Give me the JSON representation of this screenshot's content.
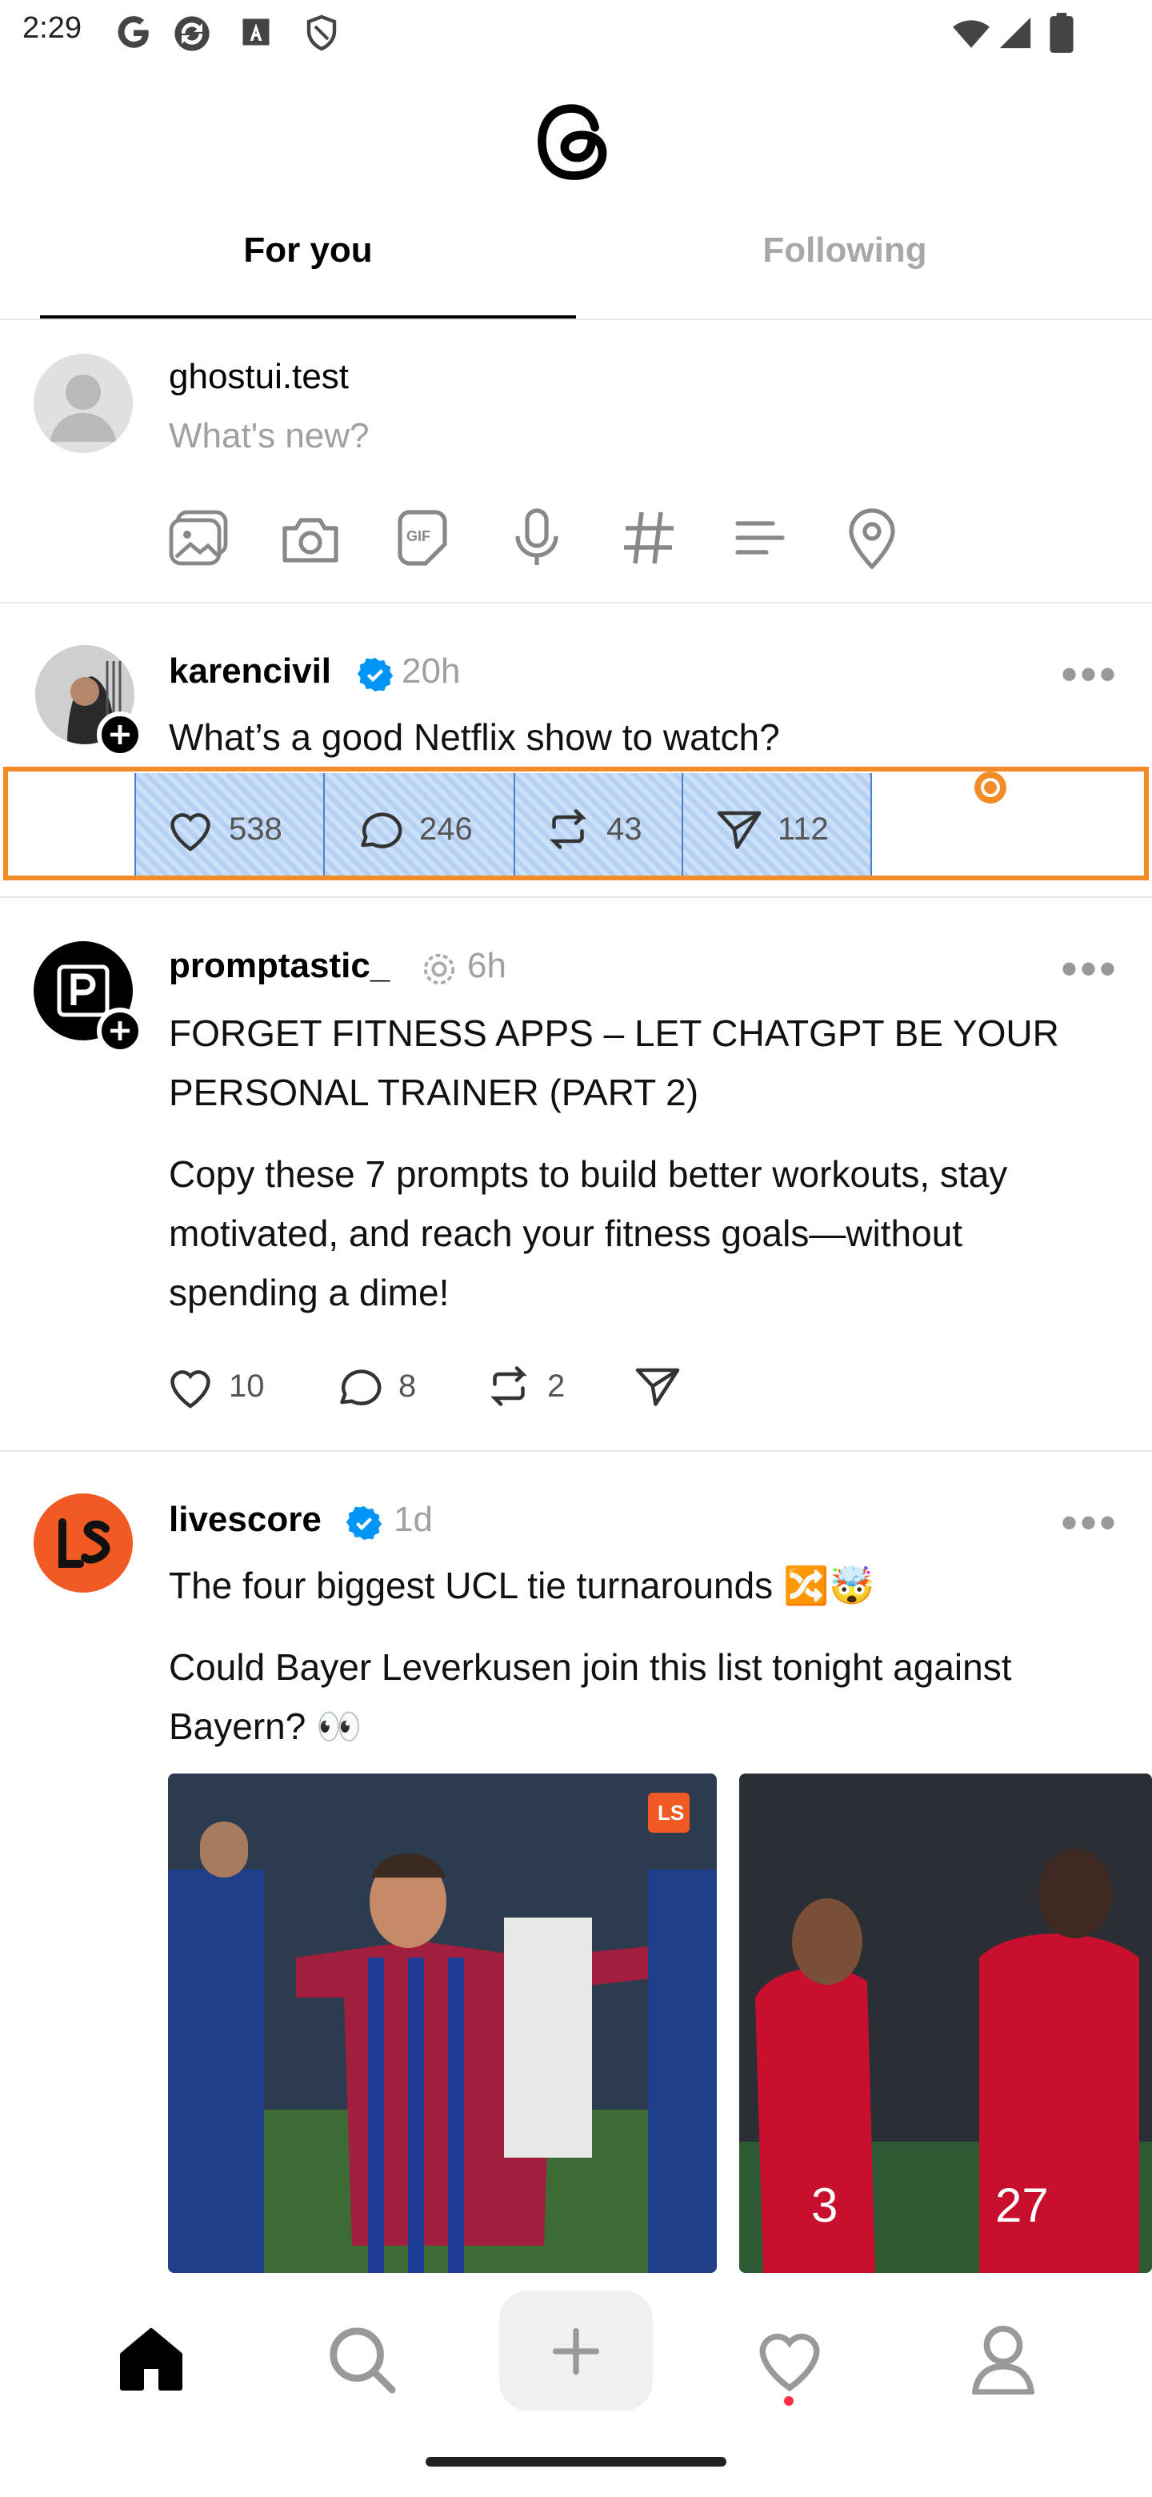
{
  "status": {
    "time": "2:29",
    "icons": [
      "google-icon",
      "sync-icon",
      "a-icon",
      "shield-icon",
      "wifi-icon",
      "signal-icon",
      "battery-icon"
    ]
  },
  "tabs": [
    {
      "label": "For you",
      "active": true
    },
    {
      "label": "Following",
      "active": false
    }
  ],
  "composer": {
    "username": "ghostui.test",
    "placeholder": "What's new?",
    "tools": [
      "gallery-icon",
      "camera-icon",
      "gif-icon",
      "mic-icon",
      "hashtag-icon",
      "poll-icon",
      "location-icon"
    ]
  },
  "posts": [
    {
      "username": "karencivil",
      "verified": true,
      "time": "20h",
      "text": "What’s a good Netflix show to watch?",
      "likes": "538",
      "comments": "246",
      "reposts": "43",
      "shares": "112"
    },
    {
      "username": "promptastic_",
      "verified": false,
      "time": "6h",
      "title": "FORGET FITNESS APPS – LET CHATGPT BE YOUR PERSONAL TRAINER (PART 2)",
      "text": "Copy these 7 prompts to build better workouts, stay motivated, and reach your fitness goals—without spending a dime!",
      "likes": "10",
      "comments": "8",
      "reposts": "2"
    },
    {
      "username": "livescore",
      "verified": true,
      "time": "1d",
      "title": "The four biggest UCL tie turnarounds 🔀🤯",
      "text": "Could Bayer Leverkusen join this list tonight against Bayern? 👀",
      "image_badge": "LS"
    }
  ],
  "colors": {
    "accent": "#0095f6",
    "overlay": "#f28c28",
    "livescore": "#f15a22",
    "notification": "#ff3040"
  }
}
